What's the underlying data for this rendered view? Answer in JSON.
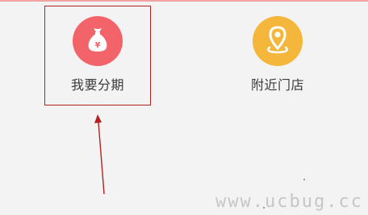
{
  "features": [
    {
      "label": "我要分期",
      "icon": "money-bag-icon",
      "icon_symbol": "¥",
      "color": "#f2636a"
    },
    {
      "label": "附近门店",
      "icon": "location-pin-icon",
      "color": "#f5b63c"
    }
  ],
  "annotation": {
    "box_color": "#b32020",
    "arrow_color": "#b32020"
  },
  "watermark": "www.ucbug.cc"
}
